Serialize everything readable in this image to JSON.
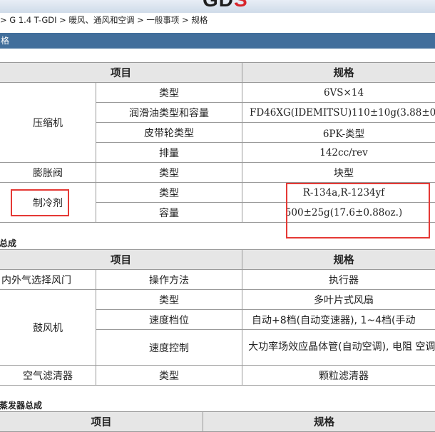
{
  "header": {
    "logo_main": "GD",
    "logo_accent": "S",
    "breadcrumb": "> G 1.4 T-GDI > 暖风、通风和空调 > 一般事项 > 规格",
    "section_title": "格"
  },
  "colors": {
    "section_bar": "#416e9b",
    "table_header": "#e6e6e6",
    "highlight_box": "#e53935",
    "border": "#9a9a9a"
  },
  "table1": {
    "headers": {
      "item": "项目",
      "spec": "规格"
    },
    "compressor": {
      "label": "压缩机",
      "rows": [
        {
          "name": "类型",
          "value": "6VS×14"
        },
        {
          "name": "润滑油类型和容量",
          "value": "FD46XG(IDEMITSU)110±10g(3.88±0."
        },
        {
          "name": "皮带轮类型",
          "value": "6PK-类型"
        },
        {
          "name": "排量",
          "value": "142cc/rev"
        }
      ]
    },
    "expansion_valve": {
      "label": "膨胀阀",
      "name": "类型",
      "value": "块型"
    },
    "refrigerant": {
      "label": "制冷剂",
      "rows": [
        {
          "name": "类型",
          "value": "R-134a,R-1234yf"
        },
        {
          "name": "容量",
          "value": "500±25g(17.6±0.88oz.)"
        }
      ]
    }
  },
  "section2_title": "总成",
  "table2": {
    "headers": {
      "item": "项目",
      "spec": "规格"
    },
    "air_door": {
      "label": "内外气选择风门",
      "name": "操作方法",
      "value": "执行器"
    },
    "blower": {
      "label": "鼓风机",
      "rows": [
        {
          "name": "类型",
          "value": "多叶片式风扇"
        },
        {
          "name": "速度档位",
          "value": "自动+8档(自动变速器), 1~4档(手动"
        },
        {
          "name": "速度控制",
          "value": "大功率场效应晶体管(自动空调), 电阻 空调)"
        }
      ]
    },
    "air_filter": {
      "label": "空气滤清器",
      "name": "类型",
      "value": "颗粒滤清器"
    }
  },
  "section3_title": "蒸发器总成",
  "table3": {
    "headers": {
      "item": "项目",
      "spec": "规格"
    }
  }
}
